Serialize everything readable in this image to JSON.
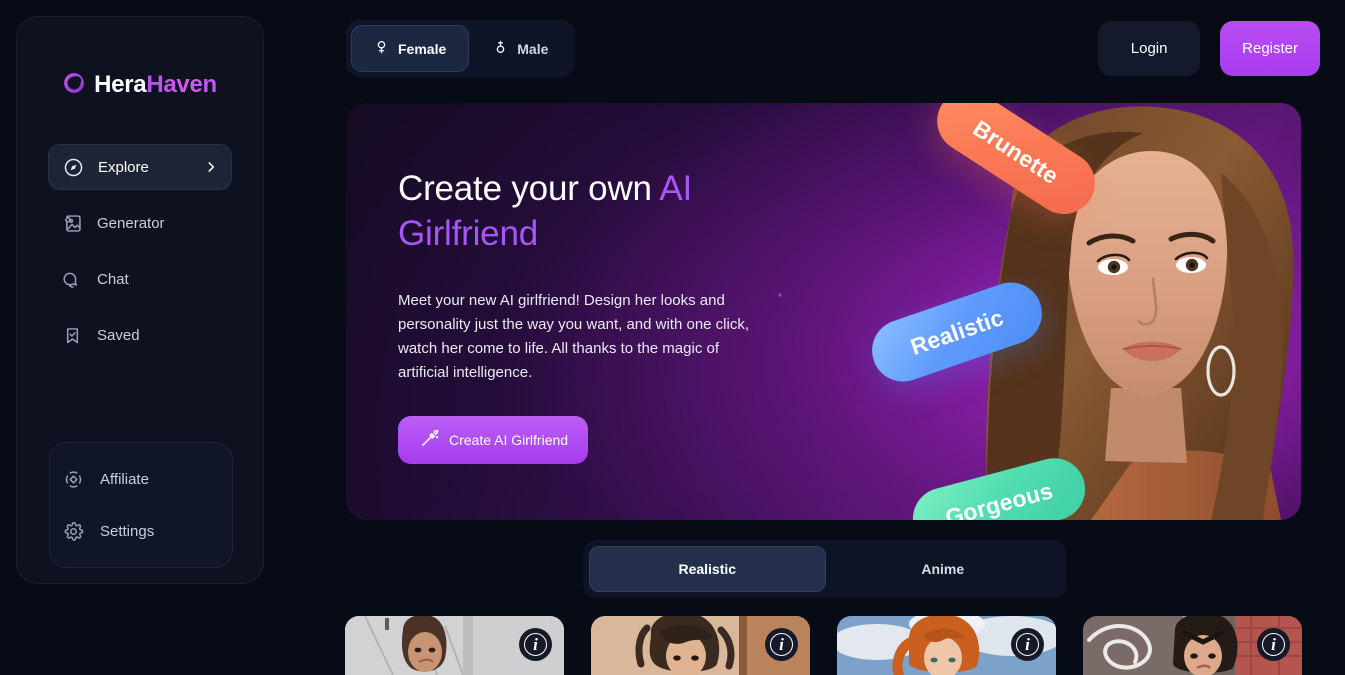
{
  "brand": {
    "word1": "Hera",
    "word2": "Haven",
    "logo_icon": "circle-logo-icon"
  },
  "sidebar": {
    "primary_items": [
      {
        "label": "Explore",
        "icon": "compass-icon",
        "active": true,
        "chevron": "chevron-right-icon"
      },
      {
        "label": "Generator",
        "icon": "image-generate-icon",
        "active": false
      },
      {
        "label": "Chat",
        "icon": "chat-bubble-icon",
        "active": false
      },
      {
        "label": "Saved",
        "icon": "bookmark-check-icon",
        "active": false
      }
    ],
    "secondary_items": [
      {
        "label": "Affiliate",
        "icon": "diamond-target-icon"
      },
      {
        "label": "Settings",
        "icon": "gear-icon"
      }
    ]
  },
  "topbar": {
    "gender_tabs": [
      {
        "label": "Female",
        "icon": "female-venus-icon",
        "active": true
      },
      {
        "label": "Male",
        "icon": "male-mars-icon",
        "active": false
      }
    ],
    "login_label": "Login",
    "register_label": "Register"
  },
  "hero": {
    "title_plain": "Create your own ",
    "title_accent": "AI Girlfriend",
    "description": "Meet your new AI girlfriend! Design her looks and personality just the way you want, and with one click, watch her come to life. All thanks to the magic of artificial intelligence.",
    "cta_label": "Create AI Girlfriend",
    "cta_icon": "magic-wand-icon",
    "pills": [
      {
        "label": "Brunette",
        "color": "#fb7a55"
      },
      {
        "label": "Realistic",
        "color": "#5f9bfb"
      },
      {
        "label": "Gorgeous",
        "color": "#4fdcb0"
      }
    ]
  },
  "style_tabs": [
    {
      "label": "Realistic",
      "active": true
    },
    {
      "label": "Anime",
      "active": false
    }
  ],
  "cards": [
    {
      "info_icon": "info-icon",
      "info_glyph": "i"
    },
    {
      "info_icon": "info-icon",
      "info_glyph": "i"
    },
    {
      "info_icon": "info-icon",
      "info_glyph": "i"
    },
    {
      "info_icon": "info-icon",
      "info_glyph": "i"
    }
  ],
  "colors": {
    "page_bg": "#070b15",
    "sidebar_bg": "#0d1120",
    "accent_purple": "#a855f7",
    "register_gradient_start": "#b94df2",
    "register_gradient_end": "#a83cef"
  }
}
